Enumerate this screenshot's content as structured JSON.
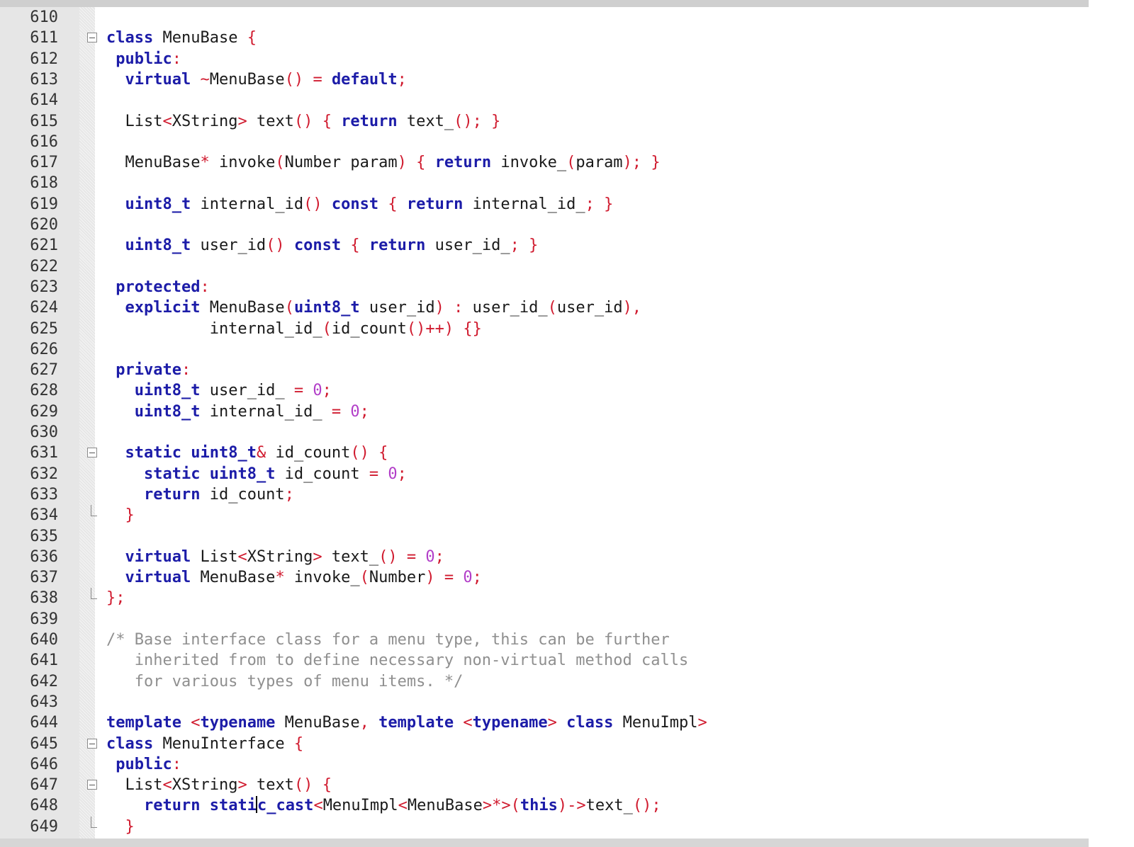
{
  "editor": {
    "lines": [
      {
        "n": "610",
        "t": []
      },
      {
        "n": "611",
        "fold": "open",
        "t": [
          [
            "kw",
            "class"
          ],
          [
            "tx",
            " MenuBase "
          ],
          [
            "pn",
            "{"
          ]
        ]
      },
      {
        "n": "612",
        "t": [
          [
            "tx",
            " "
          ],
          [
            "kw",
            "public"
          ],
          [
            "pn",
            ":"
          ]
        ]
      },
      {
        "n": "613",
        "t": [
          [
            "tx",
            "  "
          ],
          [
            "kw",
            "virtual"
          ],
          [
            "tx",
            " "
          ],
          [
            "pn",
            "~"
          ],
          [
            "tx",
            "MenuBase"
          ],
          [
            "pn",
            "()"
          ],
          [
            "tx",
            " "
          ],
          [
            "pn",
            "="
          ],
          [
            "tx",
            " "
          ],
          [
            "kw",
            "default"
          ],
          [
            "pn",
            ";"
          ]
        ]
      },
      {
        "n": "614",
        "t": []
      },
      {
        "n": "615",
        "t": [
          [
            "tx",
            "  List"
          ],
          [
            "pn",
            "<"
          ],
          [
            "tx",
            "XString"
          ],
          [
            "pn",
            ">"
          ],
          [
            "tx",
            " text"
          ],
          [
            "pn",
            "()"
          ],
          [
            "tx",
            " "
          ],
          [
            "pn",
            "{"
          ],
          [
            "tx",
            " "
          ],
          [
            "kw",
            "return"
          ],
          [
            "tx",
            " text_"
          ],
          [
            "pn",
            "();"
          ],
          [
            "tx",
            " "
          ],
          [
            "pn",
            "}"
          ]
        ]
      },
      {
        "n": "616",
        "t": []
      },
      {
        "n": "617",
        "t": [
          [
            "tx",
            "  MenuBase"
          ],
          [
            "pn",
            "*"
          ],
          [
            "tx",
            " invoke"
          ],
          [
            "pn",
            "("
          ],
          [
            "tx",
            "Number param"
          ],
          [
            "pn",
            ")"
          ],
          [
            "tx",
            " "
          ],
          [
            "pn",
            "{"
          ],
          [
            "tx",
            " "
          ],
          [
            "kw",
            "return"
          ],
          [
            "tx",
            " invoke_"
          ],
          [
            "pn",
            "("
          ],
          [
            "tx",
            "param"
          ],
          [
            "pn",
            ");"
          ],
          [
            "tx",
            " "
          ],
          [
            "pn",
            "}"
          ]
        ]
      },
      {
        "n": "618",
        "t": []
      },
      {
        "n": "619",
        "t": [
          [
            "tx",
            "  "
          ],
          [
            "kw",
            "uint8_t"
          ],
          [
            "tx",
            " internal_id"
          ],
          [
            "pn",
            "()"
          ],
          [
            "tx",
            " "
          ],
          [
            "kw",
            "const"
          ],
          [
            "tx",
            " "
          ],
          [
            "pn",
            "{"
          ],
          [
            "tx",
            " "
          ],
          [
            "kw",
            "return"
          ],
          [
            "tx",
            " internal_id_"
          ],
          [
            "pn",
            ";"
          ],
          [
            "tx",
            " "
          ],
          [
            "pn",
            "}"
          ]
        ]
      },
      {
        "n": "620",
        "t": []
      },
      {
        "n": "621",
        "t": [
          [
            "tx",
            "  "
          ],
          [
            "kw",
            "uint8_t"
          ],
          [
            "tx",
            " user_id"
          ],
          [
            "pn",
            "()"
          ],
          [
            "tx",
            " "
          ],
          [
            "kw",
            "const"
          ],
          [
            "tx",
            " "
          ],
          [
            "pn",
            "{"
          ],
          [
            "tx",
            " "
          ],
          [
            "kw",
            "return"
          ],
          [
            "tx",
            " user_id_"
          ],
          [
            "pn",
            ";"
          ],
          [
            "tx",
            " "
          ],
          [
            "pn",
            "}"
          ]
        ]
      },
      {
        "n": "622",
        "t": []
      },
      {
        "n": "623",
        "t": [
          [
            "tx",
            " "
          ],
          [
            "kw",
            "protected"
          ],
          [
            "pn",
            ":"
          ]
        ]
      },
      {
        "n": "624",
        "t": [
          [
            "tx",
            "  "
          ],
          [
            "kw",
            "explicit"
          ],
          [
            "tx",
            " MenuBase"
          ],
          [
            "pn",
            "("
          ],
          [
            "kw",
            "uint8_t"
          ],
          [
            "tx",
            " user_id"
          ],
          [
            "pn",
            ")"
          ],
          [
            "tx",
            " "
          ],
          [
            "pn",
            ":"
          ],
          [
            "tx",
            " user_id_"
          ],
          [
            "pn",
            "("
          ],
          [
            "tx",
            "user_id"
          ],
          [
            "pn",
            "),"
          ]
        ]
      },
      {
        "n": "625",
        "t": [
          [
            "tx",
            "           internal_id_"
          ],
          [
            "pn",
            "("
          ],
          [
            "tx",
            "id_count"
          ],
          [
            "pn",
            "()++)"
          ],
          [
            "tx",
            " "
          ],
          [
            "pn",
            "{}"
          ]
        ]
      },
      {
        "n": "626",
        "t": []
      },
      {
        "n": "627",
        "t": [
          [
            "tx",
            " "
          ],
          [
            "kw",
            "private"
          ],
          [
            "pn",
            ":"
          ]
        ]
      },
      {
        "n": "628",
        "t": [
          [
            "tx",
            "   "
          ],
          [
            "kw",
            "uint8_t"
          ],
          [
            "tx",
            " user_id_ "
          ],
          [
            "pn",
            "="
          ],
          [
            "tx",
            " "
          ],
          [
            "num",
            "0"
          ],
          [
            "pn",
            ";"
          ]
        ]
      },
      {
        "n": "629",
        "t": [
          [
            "tx",
            "   "
          ],
          [
            "kw",
            "uint8_t"
          ],
          [
            "tx",
            " internal_id_ "
          ],
          [
            "pn",
            "="
          ],
          [
            "tx",
            " "
          ],
          [
            "num",
            "0"
          ],
          [
            "pn",
            ";"
          ]
        ]
      },
      {
        "n": "630",
        "t": []
      },
      {
        "n": "631",
        "fold": "open",
        "t": [
          [
            "tx",
            "  "
          ],
          [
            "kw",
            "static"
          ],
          [
            "tx",
            " "
          ],
          [
            "kw",
            "uint8_t"
          ],
          [
            "pn",
            "&"
          ],
          [
            "tx",
            " id_count"
          ],
          [
            "pn",
            "()"
          ],
          [
            "tx",
            " "
          ],
          [
            "pn",
            "{"
          ]
        ]
      },
      {
        "n": "632",
        "t": [
          [
            "tx",
            "    "
          ],
          [
            "kw",
            "static"
          ],
          [
            "tx",
            " "
          ],
          [
            "kw",
            "uint8_t"
          ],
          [
            "tx",
            " id_count "
          ],
          [
            "pn",
            "="
          ],
          [
            "tx",
            " "
          ],
          [
            "num",
            "0"
          ],
          [
            "pn",
            ";"
          ]
        ]
      },
      {
        "n": "633",
        "t": [
          [
            "tx",
            "    "
          ],
          [
            "kw",
            "return"
          ],
          [
            "tx",
            " id_count"
          ],
          [
            "pn",
            ";"
          ]
        ]
      },
      {
        "n": "634",
        "fold": "end",
        "t": [
          [
            "tx",
            "  "
          ],
          [
            "pn",
            "}"
          ]
        ]
      },
      {
        "n": "635",
        "t": []
      },
      {
        "n": "636",
        "t": [
          [
            "tx",
            "  "
          ],
          [
            "kw",
            "virtual"
          ],
          [
            "tx",
            " List"
          ],
          [
            "pn",
            "<"
          ],
          [
            "tx",
            "XString"
          ],
          [
            "pn",
            ">"
          ],
          [
            "tx",
            " text_"
          ],
          [
            "pn",
            "()"
          ],
          [
            "tx",
            " "
          ],
          [
            "pn",
            "="
          ],
          [
            "tx",
            " "
          ],
          [
            "num",
            "0"
          ],
          [
            "pn",
            ";"
          ]
        ]
      },
      {
        "n": "637",
        "t": [
          [
            "tx",
            "  "
          ],
          [
            "kw",
            "virtual"
          ],
          [
            "tx",
            " MenuBase"
          ],
          [
            "pn",
            "*"
          ],
          [
            "tx",
            " invoke_"
          ],
          [
            "pn",
            "("
          ],
          [
            "tx",
            "Number"
          ],
          [
            "pn",
            ")"
          ],
          [
            "tx",
            " "
          ],
          [
            "pn",
            "="
          ],
          [
            "tx",
            " "
          ],
          [
            "num",
            "0"
          ],
          [
            "pn",
            ";"
          ]
        ]
      },
      {
        "n": "638",
        "fold": "end",
        "t": [
          [
            "pn",
            "};"
          ]
        ]
      },
      {
        "n": "639",
        "t": []
      },
      {
        "n": "640",
        "t": [
          [
            "cm",
            "/* Base interface class for a menu type, this can be further"
          ]
        ]
      },
      {
        "n": "641",
        "t": [
          [
            "cm",
            "   inherited from to define necessary non-virtual method calls"
          ]
        ]
      },
      {
        "n": "642",
        "t": [
          [
            "cm",
            "   for various types of menu items. */"
          ]
        ]
      },
      {
        "n": "643",
        "t": []
      },
      {
        "n": "644",
        "t": [
          [
            "kw",
            "template"
          ],
          [
            "tx",
            " "
          ],
          [
            "pn",
            "<"
          ],
          [
            "kw",
            "typename"
          ],
          [
            "tx",
            " MenuBase"
          ],
          [
            "pn",
            ","
          ],
          [
            "tx",
            " "
          ],
          [
            "kw",
            "template"
          ],
          [
            "tx",
            " "
          ],
          [
            "pn",
            "<"
          ],
          [
            "kw",
            "typename"
          ],
          [
            "pn",
            ">"
          ],
          [
            "tx",
            " "
          ],
          [
            "kw",
            "class"
          ],
          [
            "tx",
            " MenuImpl"
          ],
          [
            "pn",
            ">"
          ]
        ]
      },
      {
        "n": "645",
        "fold": "open",
        "t": [
          [
            "kw",
            "class"
          ],
          [
            "tx",
            " MenuInterface "
          ],
          [
            "pn",
            "{"
          ]
        ]
      },
      {
        "n": "646",
        "t": [
          [
            "tx",
            " "
          ],
          [
            "kw",
            "public"
          ],
          [
            "pn",
            ":"
          ]
        ]
      },
      {
        "n": "647",
        "fold": "open",
        "t": [
          [
            "tx",
            "  List"
          ],
          [
            "pn",
            "<"
          ],
          [
            "tx",
            "XString"
          ],
          [
            "pn",
            ">"
          ],
          [
            "tx",
            " text"
          ],
          [
            "pn",
            "()"
          ],
          [
            "tx",
            " "
          ],
          [
            "pn",
            "{"
          ]
        ]
      },
      {
        "n": "648",
        "t": [
          [
            "tx",
            "    "
          ],
          [
            "kw",
            "return"
          ],
          [
            "tx",
            " "
          ],
          [
            "kw",
            "stati"
          ],
          [
            "caret",
            ""
          ],
          [
            "kw",
            "c_cast"
          ],
          [
            "pn",
            "<"
          ],
          [
            "tx",
            "MenuImpl"
          ],
          [
            "pn",
            "<"
          ],
          [
            "tx",
            "MenuBase"
          ],
          [
            "pn",
            ">*>("
          ],
          [
            "kw",
            "this"
          ],
          [
            "pn",
            ")->"
          ],
          [
            "tx",
            "text_"
          ],
          [
            "pn",
            "();"
          ]
        ]
      },
      {
        "n": "649",
        "fold": "end",
        "t": [
          [
            "tx",
            "  "
          ],
          [
            "pn",
            "}"
          ]
        ]
      }
    ]
  }
}
